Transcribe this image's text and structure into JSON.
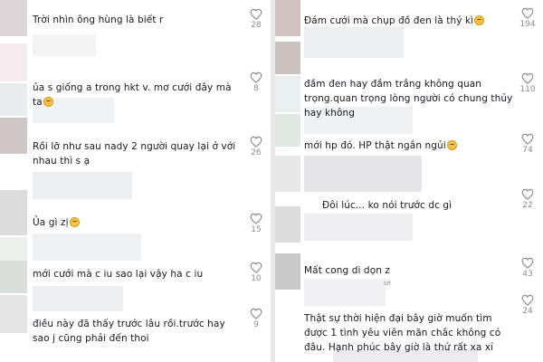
{
  "colors": {
    "text": "#161823",
    "muted": "#8a8b91",
    "background": "#ffffff",
    "separator": "#e9e9ec",
    "heart": "#8a8b91"
  },
  "icons": {
    "like": "heart-outline-icon",
    "emoji_laugh": "grinning-sweat-emoji",
    "emoji_smile": "smiling-emoji",
    "emoji_sad": "sad-emoji"
  },
  "left_comments": [
    {
      "text": "Trời nhìn ông hùng là biết r",
      "likes": "28"
    },
    {
      "text": "ủa s giống a trong hkt v. mơ cưới đây mà ta",
      "likes": "8"
    },
    {
      "text": "Rồi lỡ như sau nady 2 người quay lại ở với nhau thì s ạ",
      "likes": "26"
    },
    {
      "text": "Ủa gì zị",
      "likes": "15"
    },
    {
      "text": "mới cưới mà c iu sao lại vậy ha c iu",
      "likes": "10"
    },
    {
      "text": "điều này đã thấy trước lâu rồi.trước hay sao j cũng phải đến thoi",
      "likes": "9"
    }
  ],
  "right_comments": [
    {
      "text": "Đám cưới mà chụp đồ đen là thý kì",
      "likes": "194"
    },
    {
      "text": "đầm đen hay đầm trắng không quan trọng.quan trọng lòng người có chung thủy hay không",
      "likes": "110"
    },
    {
      "text": "mới hp đó. HP thật ngắn ngủi",
      "likes": "74"
    },
    {
      "text": "Đôi lúc... ko nói trước dc gì",
      "likes": "22"
    },
    {
      "text": "Mất cong di dọn z",
      "likes": "43",
      "subtext": "sẽ"
    },
    {
      "text": "Thật sự thời hiện đại bây giờ muốn tìm được 1 tình yêu viên mãn chắc không có đâu. Hạnh phúc bây giờ là thứ rất xa xỉ",
      "likes": "24"
    }
  ]
}
